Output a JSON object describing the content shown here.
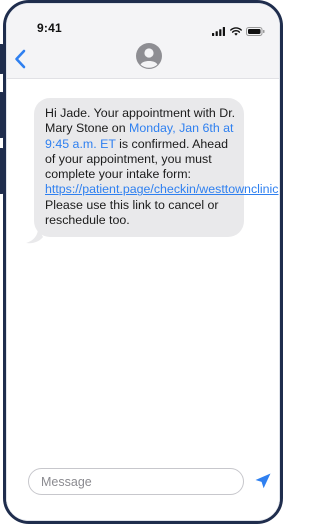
{
  "status_bar": {
    "time": "9:41",
    "icons": [
      "signal-icon",
      "wifi-icon",
      "battery-icon"
    ]
  },
  "nav": {
    "back_icon": "chevron-left-icon",
    "contact_icon": "person-avatar-icon"
  },
  "message": {
    "text_before_date": "Hi Jade. Your appointment with Dr. Mary Stone on ",
    "date_highlight": "Monday, Jan 6th at 9:45 a.m. ET",
    "text_after_date": " is confirmed. Ahead of your appointment, you must complete your intake form: ",
    "link": "https://patient.page/checkin/westtownclinic",
    "text_after_link": " Please use this link to cancel or reschedule too."
  },
  "composer": {
    "placeholder": "Message",
    "send_icon": "send-arrow-icon"
  },
  "colors": {
    "accent": "#2f80f0",
    "frame": "#1f2d4d",
    "bubble": "#e9e9eb"
  }
}
